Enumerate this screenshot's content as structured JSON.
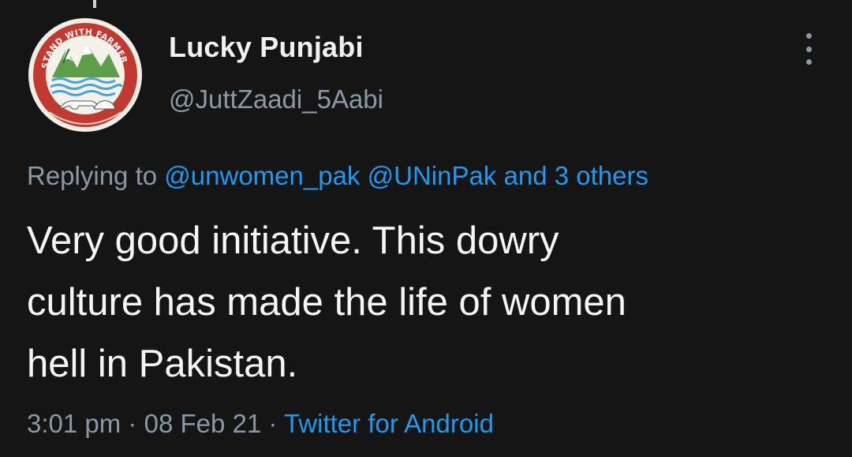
{
  "avatar": {
    "logo_text": "STAND WITH FARMER",
    "colors": {
      "ring": "#c0392b",
      "inner": "#f4f1e8",
      "mountain": "#6aa84f",
      "water": "#5dade2"
    }
  },
  "user": {
    "display_name": "Lucky Punjabi",
    "handle": "@JuttZaadi_5Aabi"
  },
  "reply": {
    "prefix": "Replying to",
    "mention_1": "@unwomen_pak",
    "mention_2": "@UNinPak",
    "others": "and 3 others"
  },
  "tweet": {
    "line_1": "Very good initiative. This dowry",
    "line_2": "culture has made the life of women",
    "line_3": "hell in Pakistan."
  },
  "meta": {
    "time": "3:01 pm",
    "separator": "·",
    "date": "08 Feb 21",
    "source": "Twitter for Android"
  },
  "colors": {
    "background": "#151515",
    "link": "#1d9bf0",
    "muted": "#8b98a5",
    "text": "#f5f5f5"
  },
  "icons": {
    "more": "vertical-dots-icon"
  }
}
